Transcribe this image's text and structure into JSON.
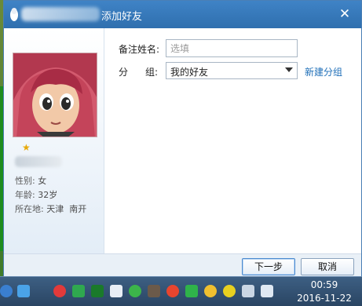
{
  "window": {
    "title": "添加好友"
  },
  "profile": {
    "gender_label": "性别:",
    "gender": "女",
    "age_label": "年龄:",
    "age": "32岁",
    "location_label": "所在地:",
    "location": "天津  南开"
  },
  "form": {
    "remark_label": "备注姓名:",
    "remark_placeholder": "选填",
    "group_label_a": "分",
    "group_label_b": "组:",
    "group_value": "我的好友",
    "new_group_link": "新建分组"
  },
  "buttons": {
    "next": "下一步",
    "cancel": "取消"
  },
  "taskbar": {
    "time": "00:59",
    "date": "2016-11-22"
  },
  "colors": {
    "titlebar": "#3f83c6",
    "link": "#1f6fb8",
    "taskbar": "#2a4563"
  },
  "icons": [
    "close-icon",
    "star-icon",
    "dropdown-arrow-icon"
  ]
}
